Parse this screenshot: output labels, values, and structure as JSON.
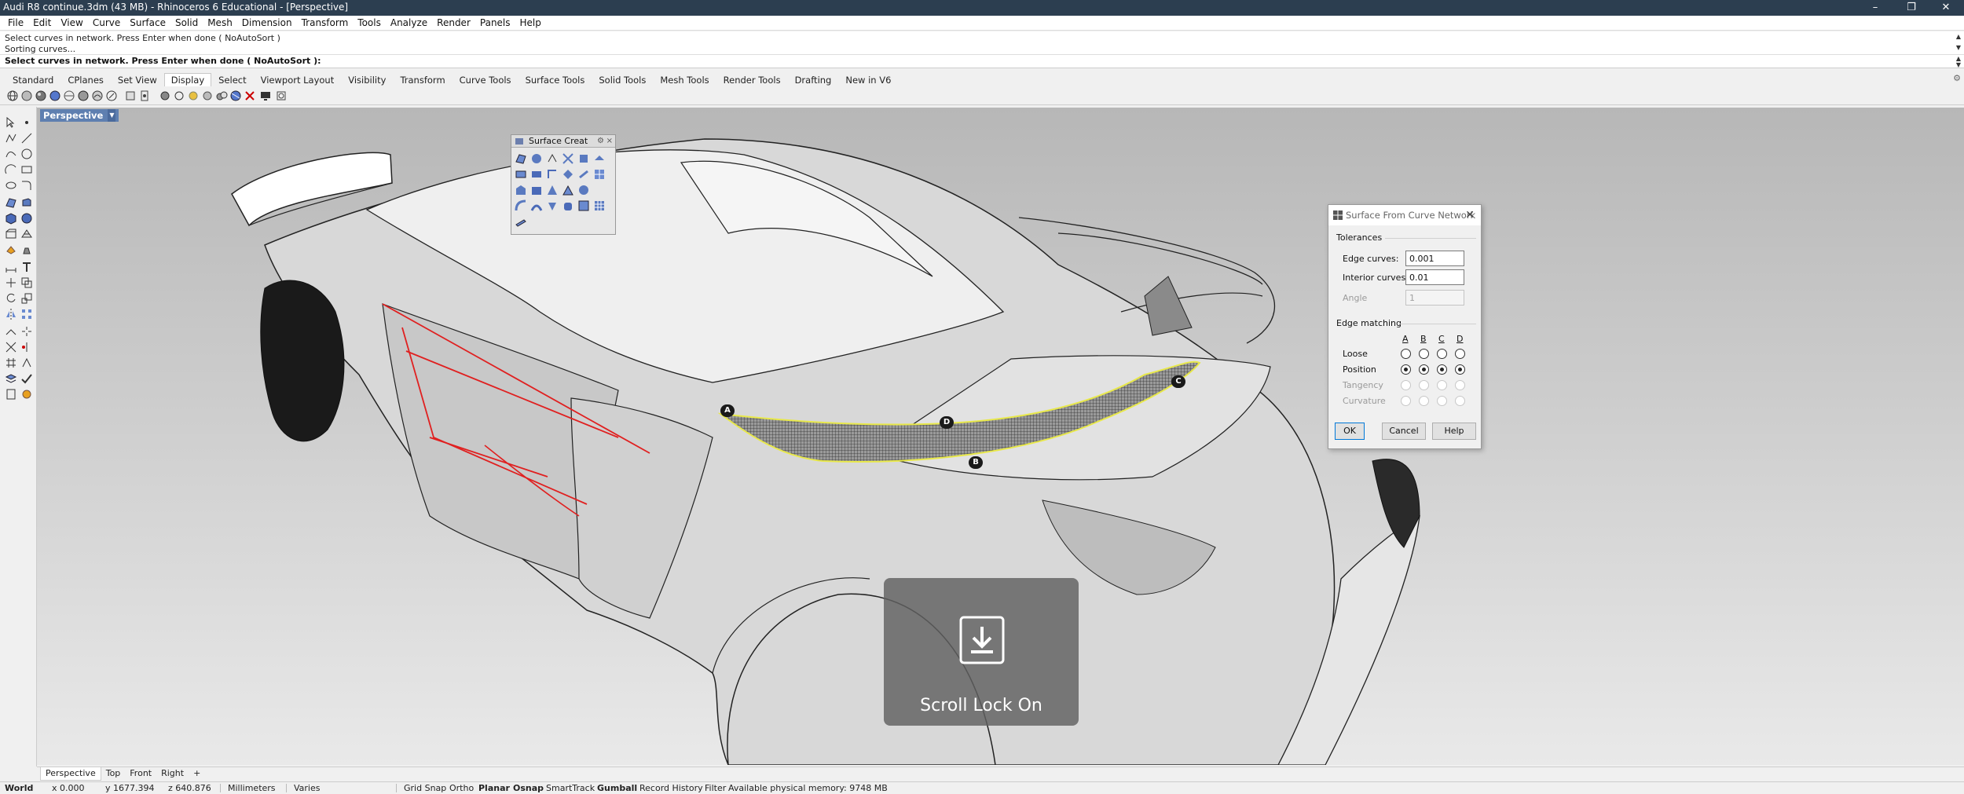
{
  "window": {
    "title": "Audi R8 continue.3dm (43 MB) - Rhinoceros 6 Educational - [Perspective]",
    "min": "–",
    "max": "❐",
    "close": "✕"
  },
  "menu": [
    "File",
    "Edit",
    "View",
    "Curve",
    "Surface",
    "Solid",
    "Mesh",
    "Dimension",
    "Transform",
    "Tools",
    "Analyze",
    "Render",
    "Panels",
    "Help"
  ],
  "command_history": [
    "Select curves in network. Press Enter when done ( NoAutoSort )",
    "Sorting curves..."
  ],
  "command_prompt": "Select curves in network. Press Enter when done ( NoAutoSort ):",
  "toolbar_tabs": [
    "Standard",
    "CPlanes",
    "Set View",
    "Display",
    "Select",
    "Viewport Layout",
    "Visibility",
    "Transform",
    "Curve Tools",
    "Surface Tools",
    "Solid Tools",
    "Mesh Tools",
    "Render Tools",
    "Drafting",
    "New in V6"
  ],
  "active_tab": "Display",
  "viewport": {
    "title": "Perspective",
    "caret": "▼",
    "point_labels": [
      "A",
      "B",
      "C",
      "D"
    ]
  },
  "surface_panel": {
    "title": "Surface Creat",
    "gear": "⚙",
    "close": "×"
  },
  "dialog": {
    "title": "Surface From Curve Network",
    "close": "✕",
    "tolerances_label": "Tolerances",
    "edge_curves_label": "Edge curves:",
    "edge_curves_value": "0.001",
    "interior_curves_label": "Interior curves:",
    "interior_curves_value": "0.01",
    "angle_label": "Angle",
    "angle_value": "1",
    "edge_matching_label": "Edge matching",
    "columns": [
      "A",
      "B",
      "C",
      "D"
    ],
    "rows": [
      {
        "label": "Loose",
        "selected": [
          false,
          false,
          false,
          false
        ],
        "disabled": false
      },
      {
        "label": "Position",
        "selected": [
          true,
          true,
          true,
          true
        ],
        "disabled": false
      },
      {
        "label": "Tangency",
        "selected": [
          false,
          false,
          false,
          false
        ],
        "disabled": true
      },
      {
        "label": "Curvature",
        "selected": [
          false,
          false,
          false,
          false
        ],
        "disabled": true
      }
    ],
    "ok": "OK",
    "cancel": "Cancel",
    "help": "Help"
  },
  "scroll_lock": {
    "text": "Scroll Lock On"
  },
  "viewport_tabs": [
    "Perspective",
    "Top",
    "Front",
    "Right"
  ],
  "viewport_tabs_add": "+",
  "status": {
    "cplane": "World",
    "x": "x 0.000",
    "y": "y 1677.394",
    "z": "z 640.876",
    "units": "Millimeters",
    "layer": "Varies",
    "grid_snap": "Grid Snap",
    "ortho": "Ortho",
    "planar": "Planar",
    "osnap": "Osnap",
    "smarttrack": "SmartTrack",
    "gumball": "Gumball",
    "record_history": "Record History",
    "filter": "Filter",
    "memory": "Available physical memory: 9748 MB"
  },
  "colors": {
    "titlebar": "#2c3e50",
    "viewport_title": "#5e7fb0",
    "selected_edges": "#e02020",
    "mesh_highlight": "#e8e84a"
  }
}
